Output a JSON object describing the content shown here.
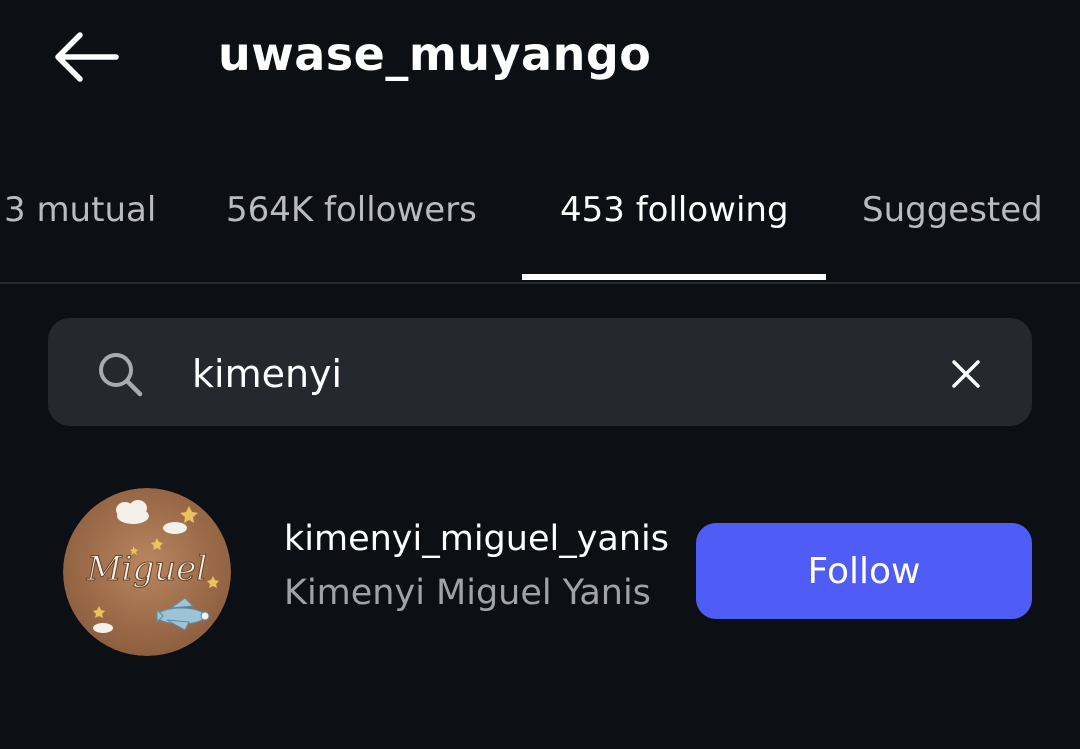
{
  "header": {
    "title": "uwase_muyango",
    "back_icon": "back-arrow-icon"
  },
  "tabs": [
    {
      "label": "3 mutual",
      "active": false
    },
    {
      "label": "564K followers",
      "active": false
    },
    {
      "label": "453 following",
      "active": true
    },
    {
      "label": "Suggested",
      "active": false
    }
  ],
  "search": {
    "value": "kimenyi",
    "icon": "search-icon",
    "clear_icon": "close-icon"
  },
  "results": [
    {
      "username": "kimenyi_miguel_yanis",
      "full_name": "Kimenyi Miguel Yanis",
      "avatar_text": "Miguel",
      "follow_label": "Follow"
    }
  ],
  "colors": {
    "background": "#0c0f14",
    "search_bg": "#25282e",
    "follow_button": "#4f5cf5",
    "secondary_text": "#9fa2a7"
  }
}
